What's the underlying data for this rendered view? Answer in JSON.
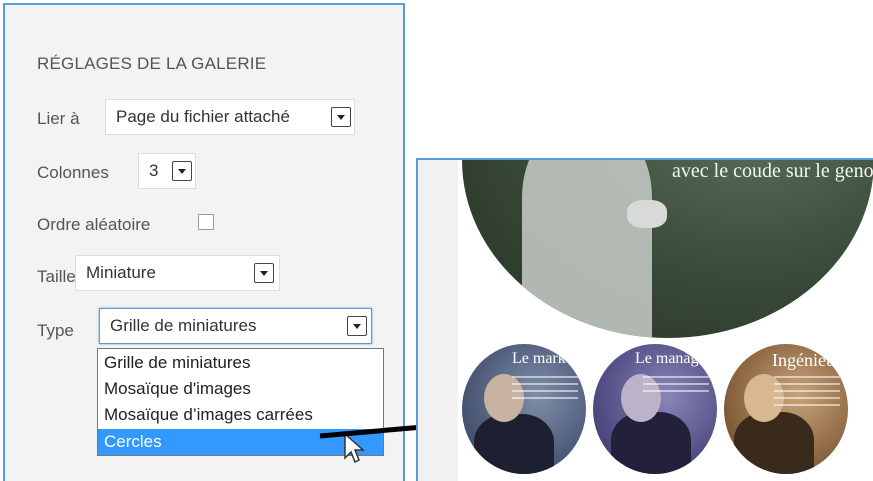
{
  "panel": {
    "title": "RÉGLAGES DE LA GALERIE",
    "link_label": "Lier à",
    "link_value": "Page du fichier attaché",
    "columns_label": "Colonnes",
    "columns_value": "3",
    "random_label": "Ordre aléatoire",
    "size_label": "Taille",
    "size_value": "Miniature",
    "type_label": "Type",
    "type_value": "Grille de miniatures",
    "type_options": [
      "Grille de miniatures",
      "Mosaïque d'images",
      "Mosaïque d’images carrées",
      "Cercles"
    ]
  },
  "preview": {
    "big_text": "avec le coude sur le genou.",
    "circles": [
      {
        "title": "Le marketing"
      },
      {
        "title": "Le management"
      },
      {
        "title": "Ingénieur"
      }
    ]
  },
  "icons": [
    "chevron-down-icon",
    "checkbox",
    "mouse-cursor-icon",
    "arrow-right-icon"
  ],
  "colors": {
    "accent": "#5b9bd5",
    "selected": "#3399ff"
  }
}
